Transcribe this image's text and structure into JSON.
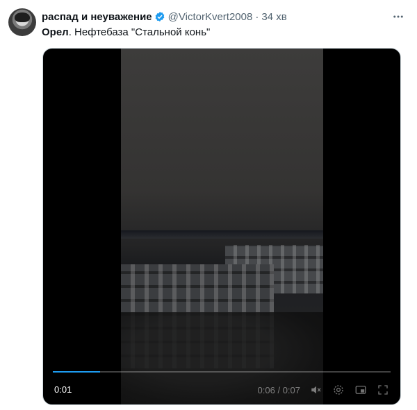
{
  "author": {
    "name": "распад и неуважение",
    "handle": "@VictorKvert2008",
    "separator": "·",
    "time": "34 хв"
  },
  "tweet": {
    "text_bold": "Орел",
    "text_rest": ". Нефтебаза \"Стальной конь\""
  },
  "video": {
    "elapsed": "0:01",
    "position": "0:06",
    "duration": "0:07",
    "time_separator": "/",
    "progress": 0.14
  },
  "colors": {
    "verified": "#1d9bf0",
    "secondary_text": "#536471"
  },
  "icons": [
    "more-icon",
    "verified-icon",
    "volume-icon",
    "settings-icon",
    "pip-icon",
    "fullscreen-icon"
  ]
}
